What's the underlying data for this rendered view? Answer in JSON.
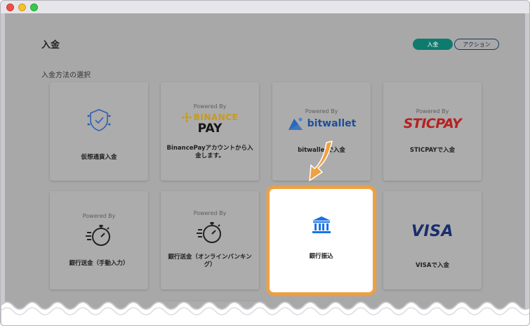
{
  "page": {
    "title": "入金",
    "section_label": "入金方法の選択"
  },
  "header_buttons": {
    "deposit": "入金",
    "action": "アクション"
  },
  "colors": {
    "accent_green": "#0e7b6e",
    "highlight_orange": "#f0a040",
    "bank_blue": "#1a73e8",
    "binance_gold": "#c99a1a"
  },
  "cards": [
    {
      "label": "仮想通貨入金",
      "icon": "crypto-shield-icon"
    },
    {
      "powered": "Powered By",
      "brand_top": "BINANCE",
      "brand_bottom": "PAY",
      "label": "BinancePayアカウントから入金します。",
      "icon": "binance-logo"
    },
    {
      "powered": "Powered By",
      "brand": "bitwallet",
      "label": "bitwalletで入金",
      "icon": "bitwallet-logo"
    },
    {
      "powered": "Powered By",
      "brand": "STICPAY",
      "label": "STICPAYで入金",
      "icon": "sticpay-logo"
    },
    {
      "powered": "Powered By",
      "label": "銀行送金（手動入力）",
      "icon": "stopwatch-icon"
    },
    {
      "powered": "Powered By",
      "label": "銀行送金（オンラインバンキング）",
      "icon": "stopwatch-icon"
    },
    {
      "label": "銀行振込",
      "icon": "bank-icon"
    },
    {
      "brand": "VISA",
      "label": "VISAで入金",
      "icon": "visa-logo"
    }
  ]
}
